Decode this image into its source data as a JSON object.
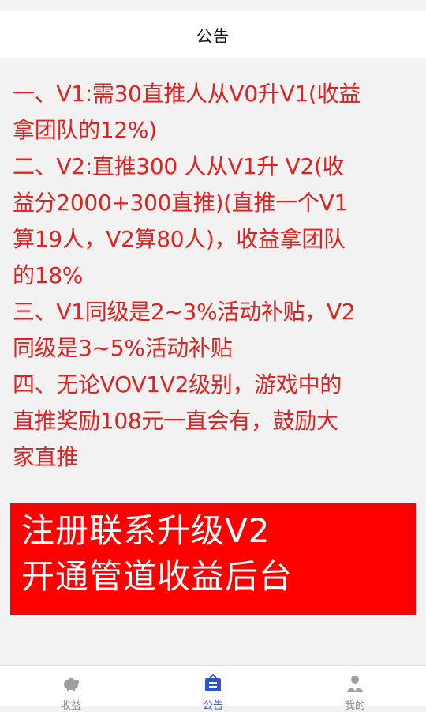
{
  "header": {
    "title": "公告"
  },
  "notice": {
    "lines": [
      "一、V1:需30直推人从V0升V1(收益",
      "拿团队的12%)",
      "二、V2:直推300 人从V1升 V2(收",
      "益分2000+300直推)(直推一个V1",
      "算19人，V2算80人)，收益拿团队",
      "的18%",
      "三、V1同级是2~3%活动补贴，V2",
      "同级是3~5%活动补贴",
      "四、无论VOV1V2级别，游戏中的",
      "直推奖励108元一直会有，鼓励大",
      "家直推"
    ],
    "color": "#e0211f"
  },
  "banner": {
    "line1": "注册联系升级V2",
    "line2": "开通管道收益后台",
    "background": "#ff0000",
    "text_color": "#ffffff"
  },
  "tabbar": {
    "tabs": [
      {
        "label": "收益",
        "icon": "piggy-bank-icon",
        "active": false
      },
      {
        "label": "公告",
        "icon": "notice-icon",
        "active": true
      },
      {
        "label": "我的",
        "icon": "user-icon",
        "active": false
      }
    ],
    "active_color": "#2f54c6",
    "inactive_color": "#888888"
  }
}
